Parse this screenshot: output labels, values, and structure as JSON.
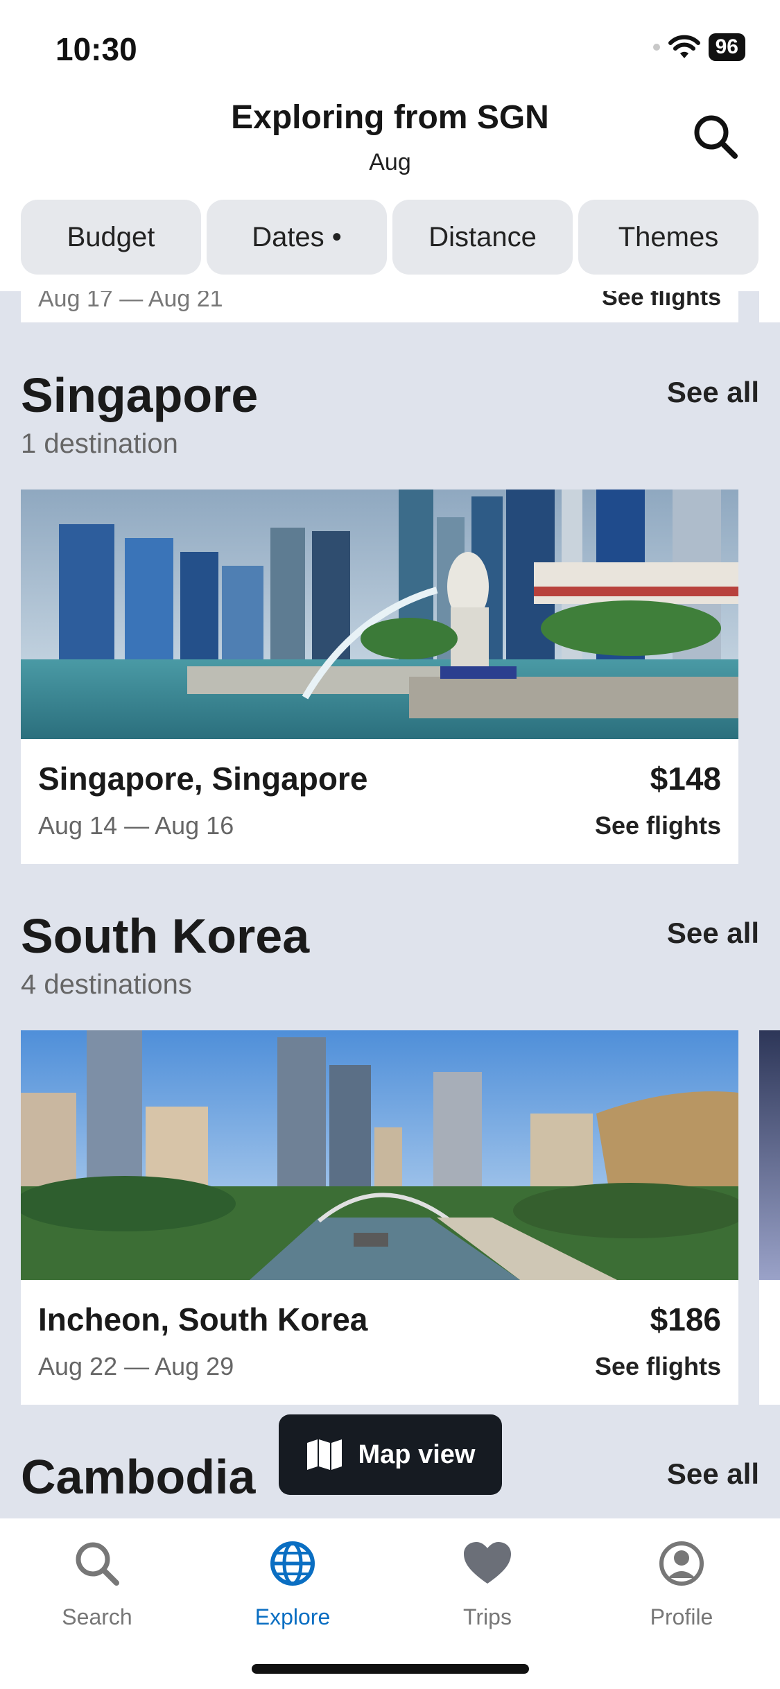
{
  "status": {
    "time": "10:30",
    "battery": "96"
  },
  "header": {
    "title": "Exploring from SGN",
    "subtitle": "Aug"
  },
  "filters": [
    "Budget",
    "Dates •",
    "Distance",
    "Themes"
  ],
  "peek": {
    "dates": "Aug 17 — Aug 21",
    "action": "See flights"
  },
  "sections": [
    {
      "title": "Singapore",
      "count": "1 destination",
      "see_all": "See all",
      "card": {
        "city": "Singapore, Singapore",
        "dates": "Aug 14 — Aug 16",
        "price": "$148",
        "action": "See flights"
      }
    },
    {
      "title": "South Korea",
      "count": "4 destinations",
      "see_all": "See all",
      "card": {
        "city": "Incheon, South Korea",
        "dates": "Aug 22 — Aug 29",
        "price": "$186",
        "action": "See flights"
      }
    },
    {
      "title": "Cambodia",
      "see_all": "See all"
    }
  ],
  "map_button": {
    "label": "Map view"
  },
  "tabs": [
    {
      "label": "Search",
      "icon": "search-icon",
      "active": false
    },
    {
      "label": "Explore",
      "icon": "globe-icon",
      "active": true
    },
    {
      "label": "Trips",
      "icon": "heart-icon",
      "active": false
    },
    {
      "label": "Profile",
      "icon": "profile-icon",
      "active": false
    }
  ],
  "colors": {
    "accent": "#0a6ec2",
    "background": "#dfe3ec",
    "dark": "#161b22"
  }
}
